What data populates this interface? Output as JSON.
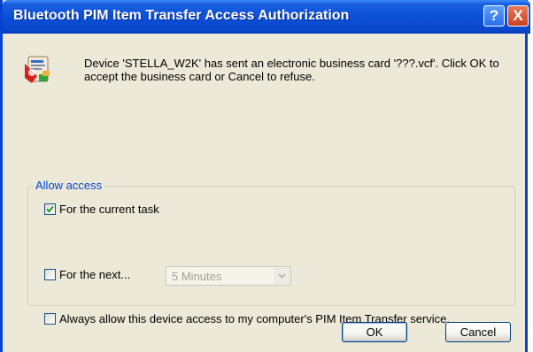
{
  "window": {
    "title": "Bluetooth PIM Item Transfer Access Authorization",
    "help_label": "?",
    "close_label": "X"
  },
  "message": "Device 'STELLA_W2K' has sent an electronic business card '???.vcf'. Click OK to accept the business card or Cancel to refuse.",
  "access": {
    "group_label": "Allow access",
    "current_task": {
      "label": "For the current task",
      "checked": true
    },
    "next": {
      "label": "For the next...",
      "checked": false,
      "duration": "5 Minutes"
    },
    "always": {
      "label": "Always allow this device access to my computer's PIM Item Transfer service.",
      "checked": false
    }
  },
  "buttons": {
    "ok": "OK",
    "cancel": "Cancel"
  },
  "colors": {
    "titlebar": "#0B4FD8",
    "window_bg": "#ECE9D8",
    "group_label": "#0046D5"
  },
  "icons": [
    "business-card-icon",
    "help-icon",
    "close-icon",
    "checkmark-icon",
    "chevron-down-icon"
  ]
}
